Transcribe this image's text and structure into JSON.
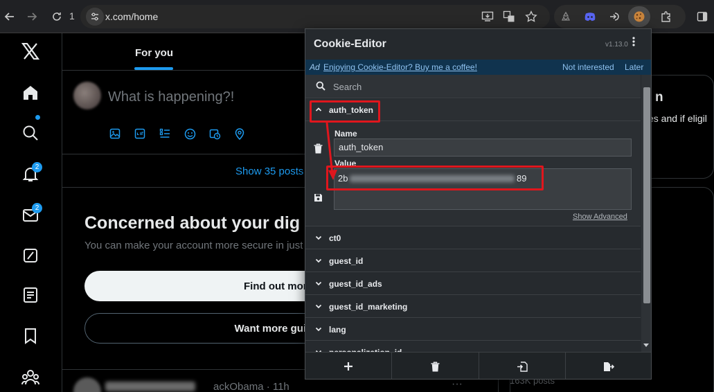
{
  "browser": {
    "tab_count": "1",
    "url": "x.com/home"
  },
  "x": {
    "nav": {
      "notifications_badge": "2",
      "messages_badge": "2"
    },
    "tab_for_you": "For you",
    "compose_placeholder": "What is happening?!",
    "show_posts": "Show 35 posts",
    "security_title": "Concerned about your dig",
    "security_subtitle": "You can make your account more secure in just a",
    "find_out_more": "Find out more",
    "want_more": "Want more guidar",
    "post": {
      "meta": "ackObama · 11h",
      "more": "···"
    },
    "right": {
      "title_fragment": "n",
      "text_fragment": "es and if eligil",
      "posts_count": "163K posts"
    }
  },
  "cookie_editor": {
    "title": "Cookie-Editor",
    "version": "v1.13.0",
    "ad_label": "Ad",
    "ad_text": "Enjoying Cookie-Editor? Buy me a coffee!",
    "not_interested": "Not interested",
    "later": "Later",
    "search_placeholder": "Search",
    "expanded_cookie": {
      "name": "auth_token",
      "name_label": "Name",
      "value_label": "Value",
      "value_prefix": "2b",
      "value_suffix": "89",
      "show_advanced": "Show Advanced"
    },
    "cookies": [
      "ct0",
      "guest_id",
      "guest_id_ads",
      "guest_id_marketing",
      "lang",
      "personalization_id"
    ]
  },
  "colors": {
    "x_blue": "#1d9bf0",
    "highlight_red": "#e0161d",
    "popup_bg": "#262a2e"
  }
}
